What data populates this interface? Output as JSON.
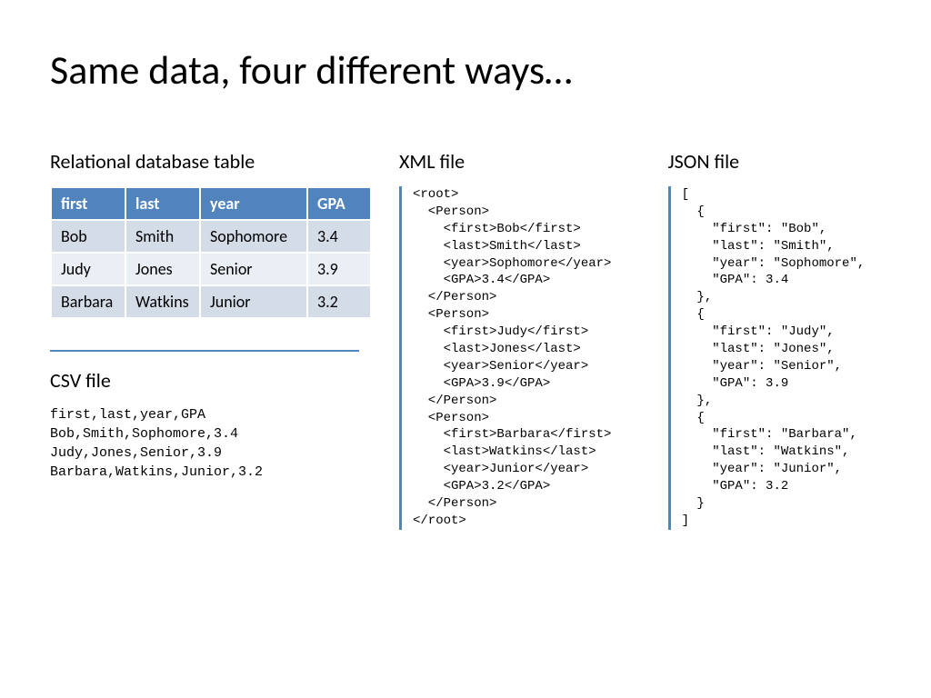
{
  "title": "Same data, four different ways…",
  "sections": {
    "table_title": "Relational database table",
    "csv_title": "CSV file",
    "xml_title": "XML file",
    "json_title": "JSON file"
  },
  "table": {
    "headers": [
      "first",
      "last",
      "year",
      "GPA"
    ],
    "rows": [
      [
        "Bob",
        "Smith",
        "Sophomore",
        "3.4"
      ],
      [
        "Judy",
        "Jones",
        "Senior",
        "3.9"
      ],
      [
        "Barbara",
        "Watkins",
        "Junior",
        "3.2"
      ]
    ]
  },
  "csv_text": "first,last,year,GPA\nBob,Smith,Sophomore,3.4\nJudy,Jones,Senior,3.9\nBarbara,Watkins,Junior,3.2",
  "xml_text": "<root>\n  <Person>\n    <first>Bob</first>\n    <last>Smith</last>\n    <year>Sophomore</year>\n    <GPA>3.4</GPA>\n  </Person>\n  <Person>\n    <first>Judy</first>\n    <last>Jones</last>\n    <year>Senior</year>\n    <GPA>3.9</GPA>\n  </Person>\n  <Person>\n    <first>Barbara</first>\n    <last>Watkins</last>\n    <year>Junior</year>\n    <GPA>3.2</GPA>\n  </Person>\n</root>",
  "json_text": "[\n  {\n    \"first\": \"Bob\",\n    \"last\": \"Smith\",\n    \"year\": \"Sophomore\",\n    \"GPA\": 3.4\n  },\n  {\n    \"first\": \"Judy\",\n    \"last\": \"Jones\",\n    \"year\": \"Senior\",\n    \"GPA\": 3.9\n  },\n  {\n    \"first\": \"Barbara\",\n    \"last\": \"Watkins\",\n    \"year\": \"Junior\",\n    \"GPA\": 3.2\n  }\n]"
}
